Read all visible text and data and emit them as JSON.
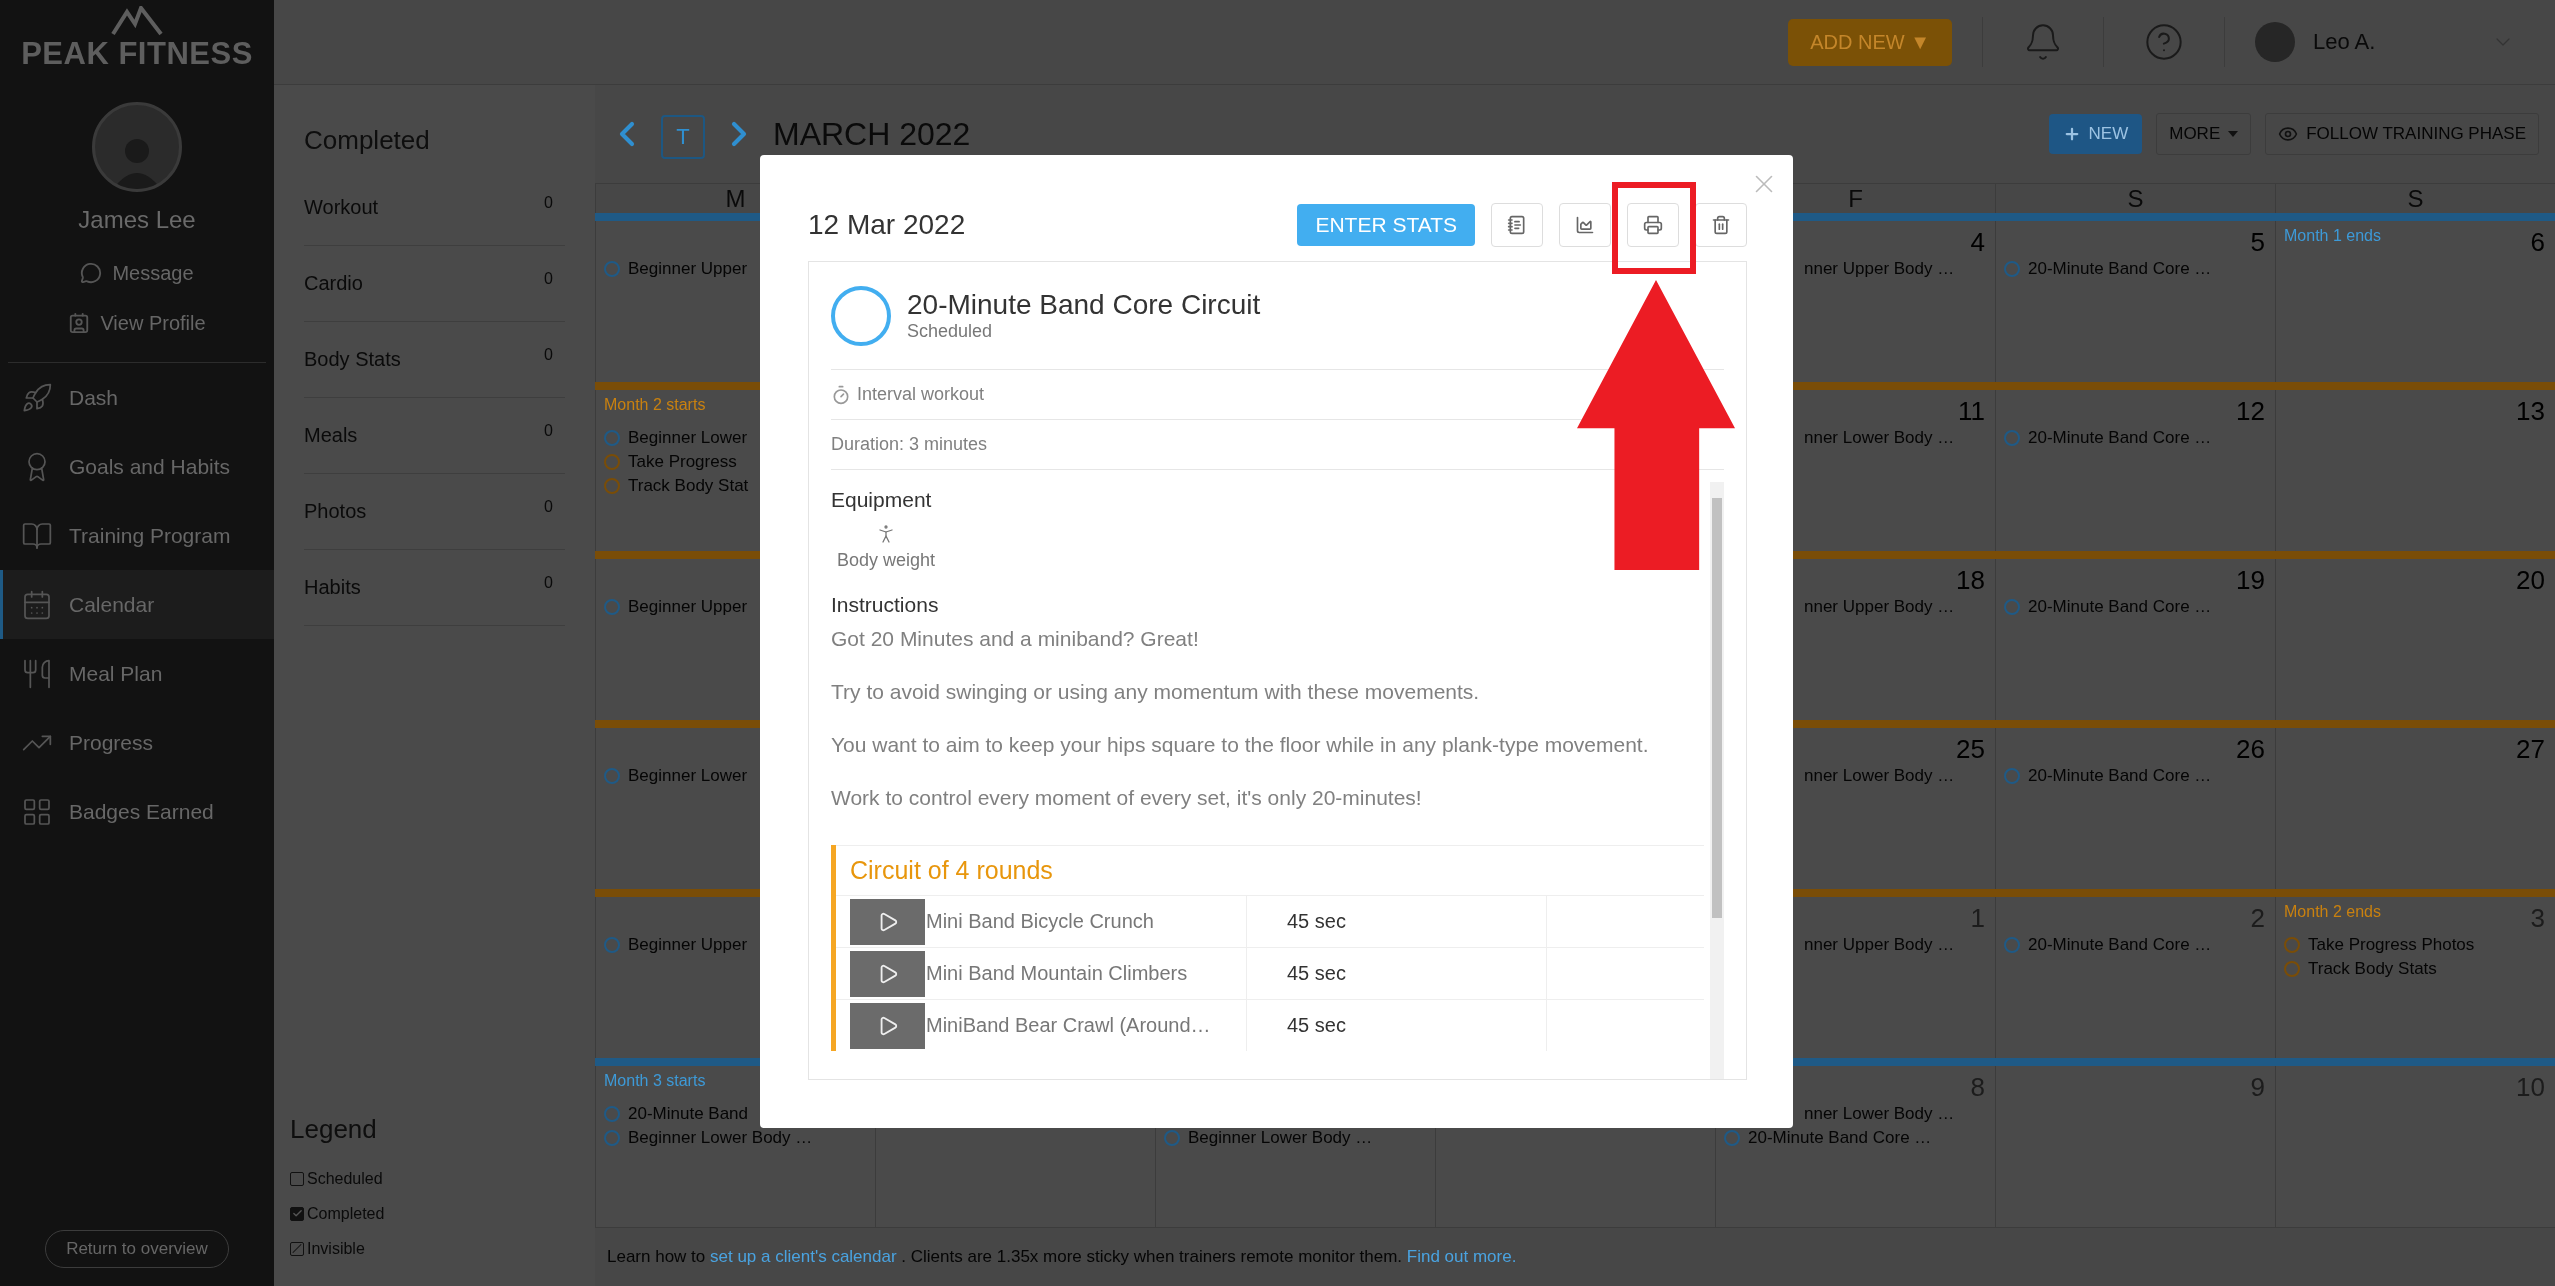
{
  "sidebar": {
    "logo": "PEAK FITNESS",
    "client_name": "James Lee",
    "profile_links": [
      {
        "label": "Message",
        "kind": "message"
      },
      {
        "label": "View Profile",
        "kind": "profile"
      }
    ],
    "nav": [
      {
        "label": "Dash",
        "kind": "dash",
        "selected": false
      },
      {
        "label": "Goals and Habits",
        "kind": "goals",
        "selected": false
      },
      {
        "label": "Training Program",
        "kind": "program",
        "selected": false
      },
      {
        "label": "Calendar",
        "kind": "calendar",
        "selected": true
      },
      {
        "label": "Meal Plan",
        "kind": "meals",
        "selected": false
      },
      {
        "label": "Progress",
        "kind": "progress",
        "selected": false
      },
      {
        "label": "Badges Earned",
        "kind": "badges",
        "selected": false
      }
    ],
    "return_button": "Return to overview"
  },
  "top_bar": {
    "add_button": "ADD NEW ▼",
    "user_name": "Leo A."
  },
  "stats": {
    "title": "Completed",
    "rows": [
      {
        "label": "Workout",
        "count": "0"
      },
      {
        "label": "Cardio",
        "count": "0"
      },
      {
        "label": "Body Stats",
        "count": "0"
      },
      {
        "label": "Meals",
        "count": "0"
      },
      {
        "label": "Photos",
        "count": "0"
      },
      {
        "label": "Habits",
        "count": "0"
      }
    ],
    "legend_title": "Legend",
    "legend": [
      {
        "label": "Scheduled",
        "checked": false,
        "slashed": false
      },
      {
        "label": "Completed",
        "checked": true,
        "slashed": false
      },
      {
        "label": "Invisible",
        "checked": false,
        "slashed": true
      }
    ]
  },
  "calendar": {
    "today_icon": "T",
    "month": "MARCH 2022",
    "new_button": "NEW",
    "more_button": "MORE",
    "follow_button": "FOLLOW TRAINING PHASE",
    "days": [
      "M",
      "F",
      "S",
      "S"
    ],
    "weeks": [
      {
        "color": "#1f5a86",
        "cells": [
          {
            "events": [
              {
                "text": "Beginner Upper",
                "color": "#1f5a86",
                "partial": false
              }
            ]
          },
          {},
          {},
          {},
          {
            "date": "4",
            "other_month": false,
            "events": [
              {
                "text": "nner Upper Body …",
                "partial": true
              }
            ]
          },
          {
            "date": "5",
            "other_month": false,
            "events": [
              {
                "text": "20-Minute Band Core …",
                "color": "#1f5a86",
                "partial": false
              }
            ]
          },
          {
            "date": "6",
            "other_month": false,
            "banner": {
              "text": "Month 1 ends",
              "color": "#3d9ad8"
            }
          }
        ]
      },
      {
        "color": "#7a4d07",
        "cells": [
          {
            "banner": {
              "text": "Month 2 starts",
              "color": "#c9810f"
            },
            "events": [
              {
                "text": "Beginner Lower",
                "color": "#1f5a86",
                "partial": false
              },
              {
                "text": "Take Progress",
                "color": "#7a4d07",
                "partial": false
              },
              {
                "text": "Track Body Stat",
                "color": "#7a4d07",
                "partial": false
              }
            ]
          },
          {},
          {},
          {},
          {
            "date": "11",
            "other_month": false,
            "events": [
              {
                "text": "nner Lower Body …",
                "partial": true
              }
            ]
          },
          {
            "date": "12",
            "other_month": false,
            "events": [
              {
                "text": "20-Minute Band Core …",
                "color": "#1f5a86",
                "partial": false
              }
            ]
          },
          {
            "date": "13",
            "other_month": false
          }
        ]
      },
      {
        "color": "#7a4d07",
        "cells": [
          {
            "events": [
              {
                "text": "Beginner Upper",
                "color": "#1f5a86",
                "partial": false
              }
            ]
          },
          {},
          {},
          {},
          {
            "date": "18",
            "other_month": false,
            "events": [
              {
                "text": "nner Upper Body …",
                "partial": true
              }
            ]
          },
          {
            "date": "19",
            "other_month": false,
            "events": [
              {
                "text": "20-Minute Band Core …",
                "color": "#1f5a86",
                "partial": false
              }
            ]
          },
          {
            "date": "20",
            "other_month": false
          }
        ]
      },
      {
        "color": "#7a4d07",
        "cells": [
          {
            "events": [
              {
                "text": "Beginner Lower",
                "color": "#1f5a86",
                "partial": false
              }
            ]
          },
          {},
          {},
          {},
          {
            "date": "25",
            "other_month": false,
            "events": [
              {
                "text": "nner Lower Body …",
                "partial": true
              }
            ]
          },
          {
            "date": "26",
            "other_month": false,
            "events": [
              {
                "text": "20-Minute Band Core …",
                "color": "#1f5a86",
                "partial": false
              }
            ]
          },
          {
            "date": "27",
            "other_month": false
          }
        ]
      },
      {
        "color": "#7a4d07",
        "cells": [
          {
            "events": [
              {
                "text": "Beginner Upper",
                "color": "#1f5a86",
                "partial": false
              }
            ]
          },
          {},
          {},
          {},
          {
            "date": "1",
            "other_month": true,
            "events": [
              {
                "text": "nner Upper Body …",
                "partial": true
              }
            ]
          },
          {
            "date": "2",
            "other_month": true,
            "events": [
              {
                "text": "20-Minute Band Core …",
                "color": "#1f5a86",
                "partial": false
              }
            ]
          },
          {
            "date": "3",
            "other_month": true,
            "banner": {
              "text": "Month 2 ends",
              "color": "#c9810f"
            },
            "events": [
              {
                "text": "Take Progress Photos",
                "color": "#7a4d07",
                "partial": false
              },
              {
                "text": "Track Body Stats",
                "color": "#7a4d07",
                "partial": false
              }
            ]
          }
        ]
      },
      {
        "color": "#1f5a86",
        "cells": [
          {
            "banner": {
              "text": "Month 3 starts",
              "color": "#3d9ad8"
            },
            "events": [
              {
                "text": "20-Minute Band",
                "color": "#1f5a86",
                "partial": false
              },
              {
                "text": "Beginner Lower Body …",
                "color": "#1f5a86",
                "partial": false
              }
            ]
          },
          {},
          {
            "covered_top": true,
            "events": [
              {
                "text": "Beginner Lower Body …",
                "color": "#1f5a86",
                "partial": false
              }
            ]
          },
          {},
          {
            "date": "8",
            "other_month": true,
            "events": [
              {
                "text": "nner Lower Body …",
                "partial": true
              },
              {
                "text": "20-Minute Band Core …",
                "color": "#1f5a86",
                "partial": false
              }
            ]
          },
          {
            "date": "9",
            "other_month": true
          },
          {
            "date": "10",
            "other_month": true
          }
        ]
      }
    ],
    "footer": [
      {
        "kind": "text",
        "text": "Learn how to "
      },
      {
        "kind": "link",
        "text": "set up a client's calendar"
      },
      {
        "kind": "text",
        "text": " . Clients are 1.35x more sticky when trainers remote monitor them. "
      },
      {
        "kind": "link",
        "text": "Find out more."
      }
    ]
  },
  "modal": {
    "date": "12 Mar 2022",
    "enter_stats_button": "ENTER STATS",
    "workout": {
      "title": "20-Minute Band Core Circuit",
      "status": "Scheduled",
      "type": "Interval workout",
      "duration": "Duration: 3 minutes",
      "equipment_title": "Equipment",
      "equipment": [
        "Body weight"
      ],
      "instructions_title": "Instructions",
      "instructions": [
        "Got 20 Minutes and a miniband? Great!",
        "Try to avoid swinging or using any momentum with these movements.",
        "You want to aim to keep your hips square to the floor while in any plank-type movement.",
        "Work to control every moment of every set, it's only 20-minutes!"
      ],
      "circuit": {
        "title": "Circuit of 4 rounds",
        "exercises": [
          {
            "name": "Mini Band Bicycle Crunch",
            "time": "45 sec"
          },
          {
            "name": "Mini Band Mountain Climbers",
            "time": "45 sec"
          },
          {
            "name": "MiniBand Bear Crawl (Around…",
            "time": "45 sec"
          }
        ]
      }
    }
  }
}
